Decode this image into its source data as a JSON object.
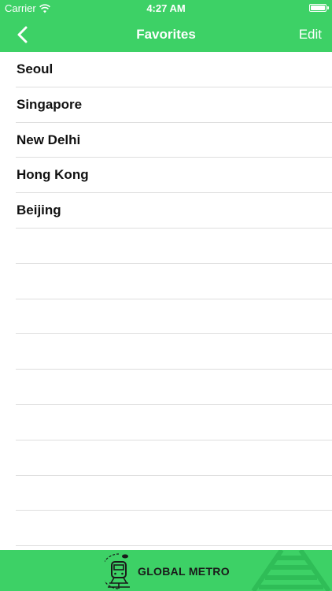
{
  "status_bar": {
    "carrier": "Carrier",
    "time": "4:27 AM",
    "wifi_icon": "wifi-icon",
    "battery_icon": "battery-icon"
  },
  "nav_bar": {
    "back_icon": "chevron-left-icon",
    "title": "Favorites",
    "edit_label": "Edit"
  },
  "favorites": {
    "items": [
      {
        "name": "Seoul"
      },
      {
        "name": "Singapore"
      },
      {
        "name": "New Delhi"
      },
      {
        "name": "Hong Kong"
      },
      {
        "name": "Beijing"
      }
    ],
    "empty_rows": 9
  },
  "footer": {
    "logo_icon": "metro-train-icon",
    "brand": "GLOBAL METRO",
    "decor_icon": "rail-tracks-icon"
  },
  "colors": {
    "accent": "#3dd166",
    "text": "#111111",
    "separator": "#dedede"
  }
}
